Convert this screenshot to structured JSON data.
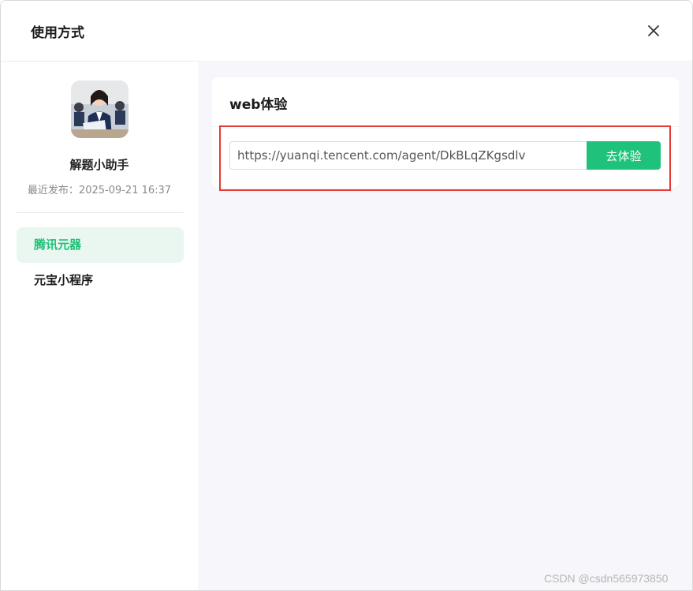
{
  "dialog": {
    "title": "使用方式",
    "close_icon": "close-icon"
  },
  "sidebar": {
    "avatar_icon": "assistant-avatar",
    "app_name": "解题小助手",
    "published": "最近发布：2025-09-21 16:37",
    "items": [
      {
        "label": "腾讯元器",
        "active": true
      },
      {
        "label": "元宝小程序",
        "active": false
      }
    ]
  },
  "main": {
    "card_title": "web体验",
    "url_value": "https://yuanqi.tencent.com/agent/DkBLqZKgsdlv",
    "go_button": "去体验"
  },
  "watermark": "CSDN @csdn565973850",
  "colors": {
    "accent": "#1fc27a",
    "active_bg": "#e9f7f0",
    "highlight": "#e53935",
    "main_bg": "#f7f6fb"
  }
}
